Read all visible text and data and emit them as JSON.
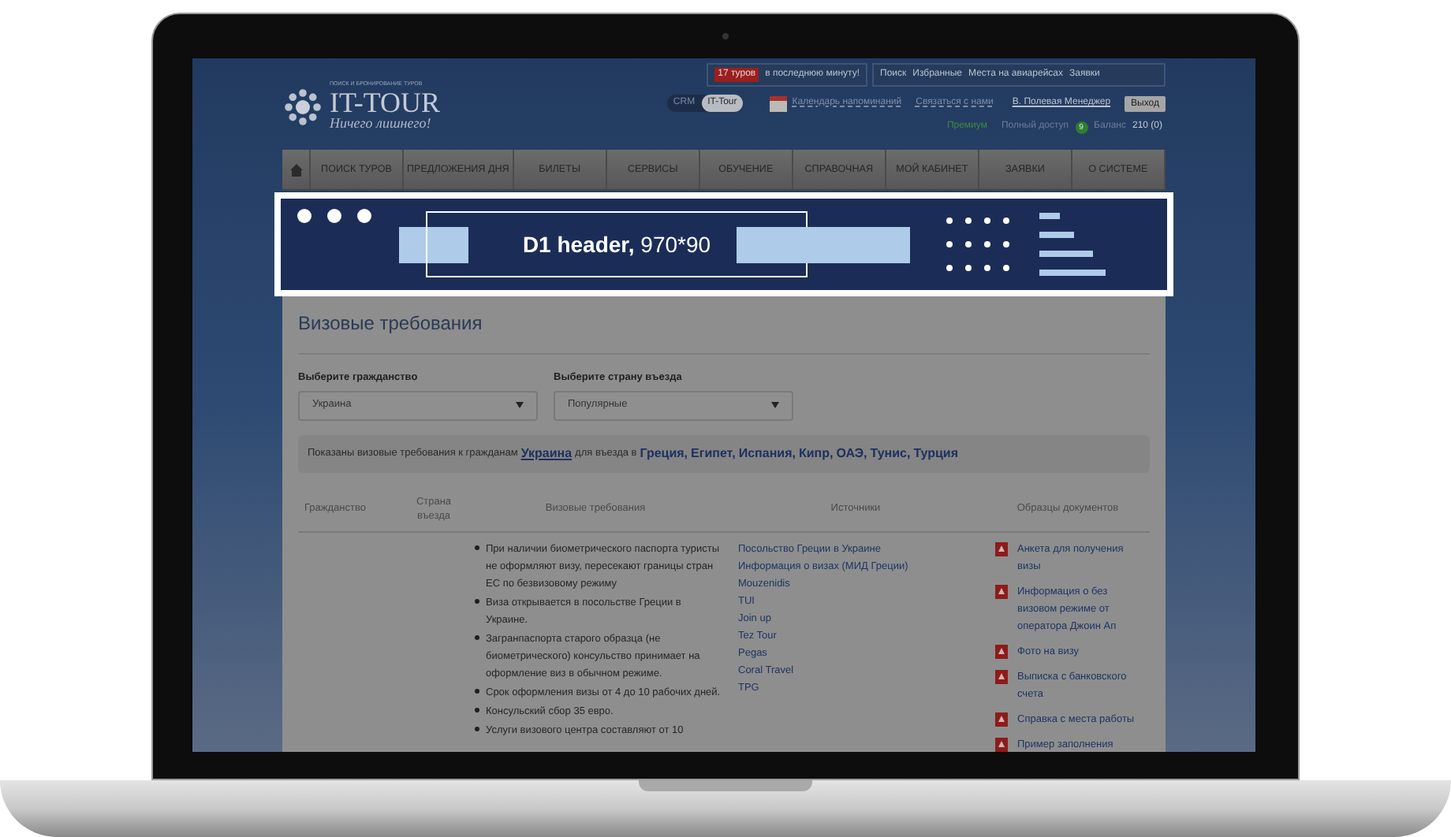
{
  "top_bar": {
    "hot_badge": "17 туров",
    "hot_text": "в последнюю минуту!",
    "links": [
      "Поиск",
      "Избранные",
      "Места на авиарейсах",
      "Заявки"
    ]
  },
  "logo": {
    "tagline": "ПОИСК И БРОНИРОВАНИЕ ТУРОВ",
    "name": "IT-TOUR",
    "slogan": "Ничего лишнего!"
  },
  "mode_toggle": [
    {
      "label": "CRM",
      "selected": false
    },
    {
      "label": "IT-Tour",
      "selected": true
    }
  ],
  "header_links": {
    "calendar": "Календарь напоминаний",
    "contact": "Связаться с нами",
    "user": "В. Полевая Менеджер",
    "logout": "Выход"
  },
  "account": {
    "plan": "Премиум",
    "access": "Полный доступ",
    "access_count": "9",
    "balance_label": "Баланс",
    "balance": "210 (0)"
  },
  "nav": [
    "ПОИСК ТУРОВ",
    "ПРЕДЛОЖЕНИЯ ДНЯ",
    "БИЛЕТЫ",
    "СЕРВИСЫ",
    "ОБУЧЕНИЕ",
    "СПРАВОЧНАЯ",
    "МОЙ КАБИНЕТ",
    "ЗАЯВКИ",
    "О СИСТЕМЕ"
  ],
  "banner": {
    "title": "D1 header,",
    "size": "970*90"
  },
  "page_title": "Визовые требования",
  "filters": [
    {
      "label": "Выберите гражданство",
      "value": "Украина"
    },
    {
      "label": "Выберите страну въезда",
      "value": "Популярные"
    }
  ],
  "notice": {
    "prefix": "Показаны визовые требования к гражданам",
    "citizenship": "Украина",
    "middle": "для въезда в",
    "countries": [
      "Греция,",
      "Египет,",
      "Испания,",
      "Кипр,",
      "ОАЭ,",
      "Тунис,",
      "Турция"
    ]
  },
  "table": {
    "columns": [
      "Гражданство",
      "Страна въезда",
      "Визовые требования",
      "Источники",
      "Образцы документов"
    ],
    "requirements": [
      "При наличии биометрического паспорта туристы не оформляют визу, пересекают границы стран ЕС по безвизовому режиму",
      "Виза открывается в посольстве Греции в Украине.",
      "Загранпаспорта старого образца (не биометрического) консульство принимает на оформление виз в обычном режиме.",
      "Срок оформления визы от 4 до 10 рабочих дней.",
      "Консульский сбор 35 евро.",
      "Услуги визового центра составляют от 10"
    ],
    "sources": [
      "Посольство Греции в Украине",
      "Информация о визах (МИД Греции)",
      "Mouzenidis",
      "TUI",
      "Join up",
      "Tez Tour",
      "Pegas",
      "Coral Travel",
      "TPG"
    ],
    "documents": [
      "Анкета для получения визы",
      "Информация о без визовом режиме от оператора Джоин Ап",
      "Фото на визу",
      "Выписка с банковского счета",
      "Справка с места работы",
      "Пример заполнения"
    ]
  }
}
